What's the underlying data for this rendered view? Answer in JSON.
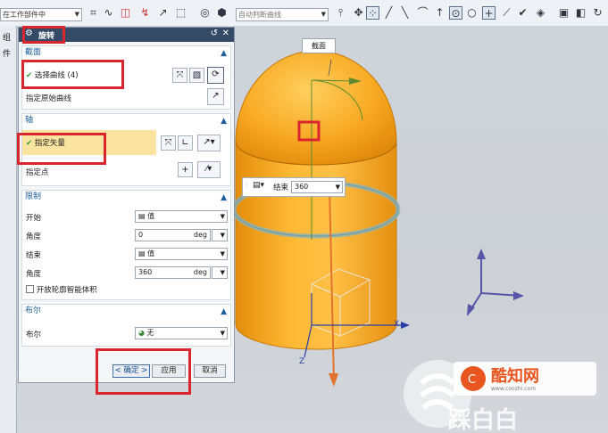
{
  "toolbar": {
    "filter_combo": "在工作部件中",
    "curve_rule_combo": "自动判断曲线",
    "icons": [
      "sketch-icon",
      "wave-icon",
      "snap-icon",
      "point-icon",
      "vector-icon",
      "line-icon",
      "curve-icon",
      "arc-icon",
      "circle-icon",
      "quadrant-icon",
      "plus-icon",
      "slash-icon",
      "wrench-icon",
      "gear-icon",
      "view-icon",
      "wcs-icon",
      "refresh-icon"
    ]
  },
  "left_strip": {
    "items": [
      "组",
      "件"
    ]
  },
  "dialog": {
    "title": "旋转",
    "section_profile": {
      "label": "截面",
      "select_curve": "选择曲线 (4)",
      "specify_origin": "指定原始曲线"
    },
    "section_axis": {
      "label": "轴",
      "specify_vector": "指定矢量",
      "specify_point": "指定点"
    },
    "section_limits": {
      "label": "限制",
      "start_label": "开始",
      "start_type": "值",
      "start_angle_label": "角度",
      "start_angle_value": "0",
      "start_angle_unit": "deg",
      "end_label": "结束",
      "end_type": "值",
      "end_angle_label": "角度",
      "end_angle_value": "360",
      "end_angle_unit": "deg",
      "open_profile_label": "开放轮廓智能体积"
    },
    "section_boolean": {
      "label": "布尔",
      "boolean_label": "布尔",
      "boolean_value": "无"
    },
    "buttons": {
      "ok": "< 确定 >",
      "apply": "应用",
      "cancel": "取消"
    }
  },
  "viewport": {
    "section_callout": "截面",
    "flyout_label": "结束",
    "flyout_value": "360",
    "axis_x": "X",
    "axis_z": "Z"
  },
  "watermark": {
    "brand": "酷知网",
    "url": "www.coozhi.com",
    "colors": {
      "brand": "#e8551f",
      "white": "#ffffff"
    }
  },
  "colors": {
    "accent_red": "#d9262e",
    "model_orange": "#f2a51c",
    "title_bar": "#344a66",
    "section_blue": "#1c5f9b",
    "highlight_yellow": "#fbe3a0"
  }
}
